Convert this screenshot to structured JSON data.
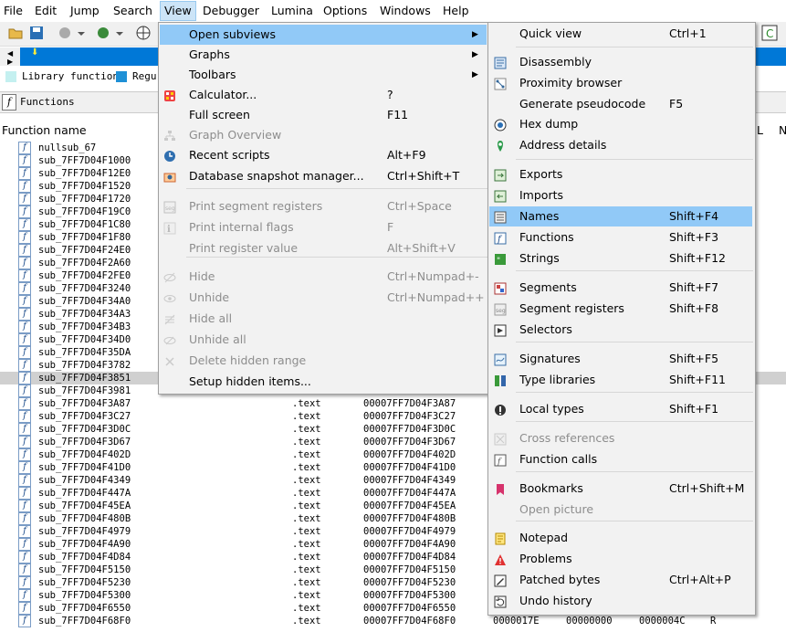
{
  "menubar": [
    "File",
    "Edit",
    "Jump",
    "Search",
    "View",
    "Debugger",
    "Lumina",
    "Options",
    "Windows",
    "Help"
  ],
  "legend": {
    "library": "Library function",
    "regular": "Regu"
  },
  "functions_tab": "Functions",
  "column_function_name": "Function name",
  "col_right_l": "L",
  "col_right_n": "N",
  "functions": [
    "nullsub_67",
    "sub_7FF7D04F1000",
    "sub_7FF7D04F12E0",
    "sub_7FF7D04F1520",
    "sub_7FF7D04F1720",
    "sub_7FF7D04F19C0",
    "sub_7FF7D04F1C80",
    "sub_7FF7D04F1F80",
    "sub_7FF7D04F24E0",
    "sub_7FF7D04F2A60",
    "sub_7FF7D04F2FE0",
    "sub_7FF7D04F3240",
    "sub_7FF7D04F34A0",
    "sub_7FF7D04F34A3",
    "sub_7FF7D04F34B3",
    "sub_7FF7D04F34D0",
    "sub_7FF7D04F35DA",
    "sub_7FF7D04F3782",
    "sub_7FF7D04F3851",
    "sub_7FF7D04F3981",
    "sub_7FF7D04F3A87",
    "sub_7FF7D04F3C27",
    "sub_7FF7D04F3D0C",
    "sub_7FF7D04F3D67",
    "sub_7FF7D04F402D",
    "sub_7FF7D04F41D0",
    "sub_7FF7D04F4349",
    "sub_7FF7D04F447A",
    "sub_7FF7D04F45EA",
    "sub_7FF7D04F480B",
    "sub_7FF7D04F4979",
    "sub_7FF7D04F4A90",
    "sub_7FF7D04F4D84",
    "sub_7FF7D04F5150",
    "sub_7FF7D04F5230",
    "sub_7FF7D04F5300",
    "sub_7FF7D04F6550",
    "sub_7FF7D04F68F0"
  ],
  "rows_detail": [
    {
      "seg": ".text",
      "start": "00007FF7D04F3A87"
    },
    {
      "seg": ".text",
      "start": "00007FF7D04F3C27"
    },
    {
      "seg": ".text",
      "start": "00007FF7D04F3D0C"
    },
    {
      "seg": ".text",
      "start": "00007FF7D04F3D67"
    },
    {
      "seg": ".text",
      "start": "00007FF7D04F402D"
    },
    {
      "seg": ".text",
      "start": "00007FF7D04F41D0"
    },
    {
      "seg": ".text",
      "start": "00007FF7D04F4349"
    },
    {
      "seg": ".text",
      "start": "00007FF7D04F447A"
    },
    {
      "seg": ".text",
      "start": "00007FF7D04F45EA"
    },
    {
      "seg": ".text",
      "start": "00007FF7D04F480B"
    },
    {
      "seg": ".text",
      "start": "00007FF7D04F4979"
    },
    {
      "seg": ".text",
      "start": "00007FF7D04F4A90"
    },
    {
      "seg": ".text",
      "start": "00007FF7D04F4D84"
    },
    {
      "seg": ".text",
      "start": "00007FF7D04F5150"
    },
    {
      "seg": ".text",
      "start": "00007FF7D04F5230"
    },
    {
      "seg": ".text",
      "start": "00007FF7D04F5300"
    },
    {
      "seg": ".text",
      "start": "00007FF7D04F6550"
    },
    {
      "seg": ".text",
      "start": "00007FF7D04F68F0",
      "c1": "0000017E",
      "c2": "00000000",
      "c3": "0000004C",
      "c4": "R"
    }
  ],
  "selected_function": "sub_7FF7D04F3851",
  "view_menu": {
    "items": [
      {
        "label": "Open subviews",
        "shortcut": "",
        "submenu": true,
        "highlighted": true,
        "disabled": false,
        "icon": ""
      },
      {
        "label": "Graphs",
        "shortcut": "",
        "submenu": true,
        "disabled": false,
        "icon": ""
      },
      {
        "label": "Toolbars",
        "shortcut": "",
        "submenu": true,
        "disabled": false,
        "icon": ""
      },
      {
        "label": "Calculator...",
        "shortcut": "?",
        "disabled": false,
        "icon": "calculator-icon"
      },
      {
        "label": "Full screen",
        "shortcut": "F11",
        "disabled": false,
        "icon": ""
      },
      {
        "label": "Graph Overview",
        "shortcut": "",
        "disabled": true,
        "icon": "graph-overview-icon"
      },
      {
        "label": "Recent scripts",
        "shortcut": "Alt+F9",
        "disabled": false,
        "icon": "recent-scripts-icon"
      },
      {
        "label": "Database snapshot manager...",
        "shortcut": "Ctrl+Shift+T",
        "disabled": false,
        "icon": "snapshot-icon"
      },
      {
        "label": "Print segment registers",
        "shortcut": "Ctrl+Space",
        "disabled": true,
        "icon": "segment-registers-icon"
      },
      {
        "label": "Print internal flags",
        "shortcut": "F",
        "disabled": true,
        "icon": "internal-flags-icon"
      },
      {
        "label": "Print register value",
        "shortcut": "Alt+Shift+V",
        "disabled": true,
        "icon": ""
      },
      {
        "label": "Hide",
        "shortcut": "Ctrl+Numpad+-",
        "disabled": true,
        "icon": "hide-icon"
      },
      {
        "label": "Unhide",
        "shortcut": "Ctrl+Numpad++",
        "disabled": true,
        "icon": "unhide-icon"
      },
      {
        "label": "Hide all",
        "shortcut": "",
        "disabled": true,
        "icon": "hide-all-icon"
      },
      {
        "label": "Unhide all",
        "shortcut": "",
        "disabled": true,
        "icon": "unhide-all-icon"
      },
      {
        "label": "Delete hidden range",
        "shortcut": "",
        "disabled": true,
        "icon": "delete-hidden-icon"
      },
      {
        "label": "Setup hidden items...",
        "shortcut": "",
        "disabled": false,
        "icon": ""
      }
    ]
  },
  "subviews_menu": {
    "items": [
      {
        "label": "Quick view",
        "shortcut": "Ctrl+1",
        "disabled": false,
        "icon": ""
      },
      {
        "label": "Disassembly",
        "shortcut": "",
        "disabled": false,
        "icon": "disassembly-icon"
      },
      {
        "label": "Proximity browser",
        "shortcut": "",
        "disabled": false,
        "icon": "proximity-icon"
      },
      {
        "label": "Generate pseudocode",
        "shortcut": "F5",
        "disabled": false,
        "icon": ""
      },
      {
        "label": "Hex dump",
        "shortcut": "",
        "disabled": false,
        "icon": "hex-dump-icon"
      },
      {
        "label": "Address details",
        "shortcut": "",
        "disabled": false,
        "icon": "address-details-icon"
      },
      {
        "label": "Exports",
        "shortcut": "",
        "disabled": false,
        "icon": "exports-icon"
      },
      {
        "label": "Imports",
        "shortcut": "",
        "disabled": false,
        "icon": "imports-icon"
      },
      {
        "label": "Names",
        "shortcut": "Shift+F4",
        "highlighted": true,
        "disabled": false,
        "icon": "names-icon"
      },
      {
        "label": "Functions",
        "shortcut": "Shift+F3",
        "disabled": false,
        "icon": "functions-icon"
      },
      {
        "label": "Strings",
        "shortcut": "Shift+F12",
        "disabled": false,
        "icon": "strings-icon"
      },
      {
        "label": "Segments",
        "shortcut": "Shift+F7",
        "disabled": false,
        "icon": "segments-icon"
      },
      {
        "label": "Segment registers",
        "shortcut": "Shift+F8",
        "disabled": false,
        "icon": "segment-registers-icon"
      },
      {
        "label": "Selectors",
        "shortcut": "",
        "disabled": false,
        "icon": "selectors-icon"
      },
      {
        "label": "Signatures",
        "shortcut": "Shift+F5",
        "disabled": false,
        "icon": "signatures-icon"
      },
      {
        "label": "Type libraries",
        "shortcut": "Shift+F11",
        "disabled": false,
        "icon": "type-libraries-icon"
      },
      {
        "label": "Local types",
        "shortcut": "Shift+F1",
        "disabled": false,
        "icon": "local-types-icon"
      },
      {
        "label": "Cross references",
        "shortcut": "",
        "disabled": true,
        "icon": "cross-references-icon"
      },
      {
        "label": "Function calls",
        "shortcut": "",
        "disabled": false,
        "icon": "function-calls-icon"
      },
      {
        "label": "Bookmarks",
        "shortcut": "Ctrl+Shift+M",
        "disabled": false,
        "icon": "bookmark-icon"
      },
      {
        "label": "Open picture",
        "shortcut": "",
        "disabled": true,
        "icon": ""
      },
      {
        "label": "Notepad",
        "shortcut": "",
        "disabled": false,
        "icon": "notepad-icon"
      },
      {
        "label": "Problems",
        "shortcut": "",
        "disabled": false,
        "icon": "problems-icon"
      },
      {
        "label": "Patched bytes",
        "shortcut": "Ctrl+Alt+P",
        "disabled": false,
        "icon": "patched-bytes-icon"
      },
      {
        "label": "Undo history",
        "shortcut": "",
        "disabled": false,
        "icon": "undo-history-icon"
      }
    ]
  }
}
